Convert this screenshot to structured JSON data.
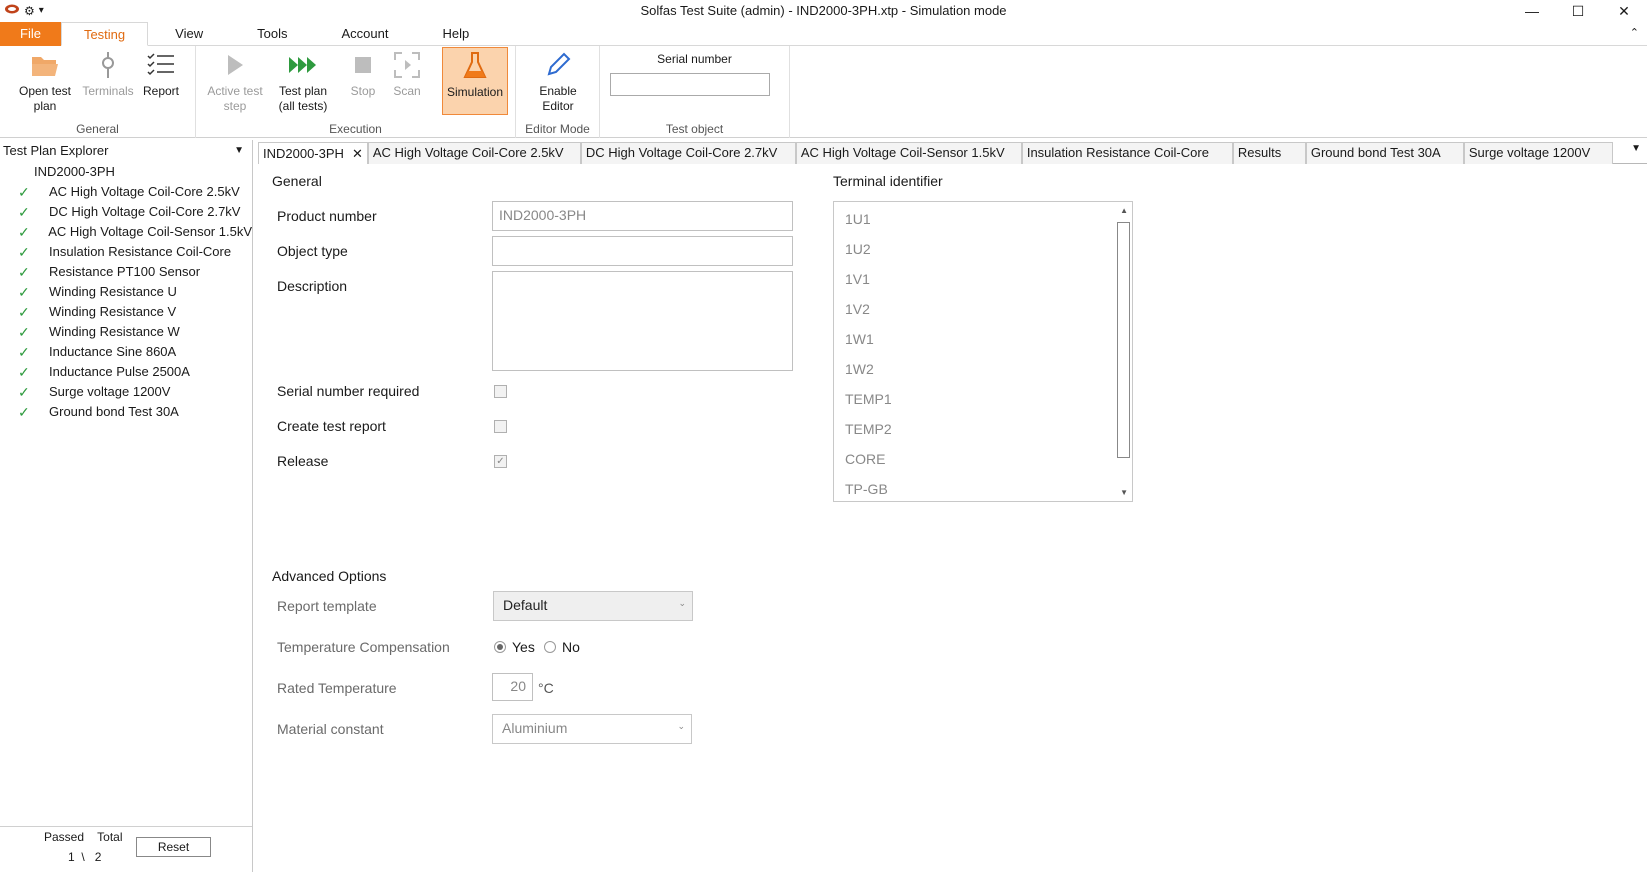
{
  "window": {
    "title": "Solfas Test Suite (admin)  - IND2000-3PH.xtp - Simulation mode",
    "qat_dropdown": "▾"
  },
  "ribbon_tabs": [
    "File",
    "Testing",
    "View",
    "Tools",
    "Account",
    "Help"
  ],
  "ribbon": {
    "general": {
      "label": "General",
      "open_test_plan": "Open test plan",
      "terminals": "Terminals",
      "report": "Report"
    },
    "execution": {
      "label": "Execution",
      "active_test_step": "Active test step",
      "test_plan_all": "Test plan (all tests)",
      "stop": "Stop",
      "scan": "Scan",
      "simulation": "Simulation"
    },
    "editor_mode": {
      "label": "Editor Mode",
      "enable_editor": "Enable Editor"
    },
    "test_object": {
      "label": "Test object",
      "serial_number_label": "Serial number",
      "serial_number_value": ""
    }
  },
  "explorer": {
    "title": "Test Plan Explorer",
    "root": "IND2000-3PH",
    "items": [
      "AC High Voltage Coil-Core 2.5kV",
      "DC High Voltage Coil-Core 2.7kV",
      "AC High Voltage Coil-Sensor 1.5kV",
      "Insulation Resistance Coil-Core",
      "Resistance PT100 Sensor",
      "Winding Resistance U",
      "Winding Resistance  V",
      "Winding Resistance  W",
      "Inductance Sine 860A",
      "Inductance Pulse 2500A",
      "Surge voltage 1200V",
      "Ground bond Test 30A"
    ],
    "footer": {
      "passed_label": "Passed",
      "total_label": "Total",
      "passed": "1",
      "separator": "\\",
      "total": "2",
      "reset": "Reset"
    }
  },
  "doc_tabs": [
    "IND2000-3PH",
    "AC High Voltage Coil-Core 2.5kV",
    "DC High Voltage Coil-Core 2.7kV",
    "AC High Voltage Coil-Sensor 1.5kV",
    "Insulation Resistance Coil-Core",
    "Results",
    "Ground bond Test 30A",
    "Surge voltage 1200V"
  ],
  "form": {
    "general_title": "General",
    "product_number_label": "Product number",
    "product_number_value": "IND2000-3PH",
    "object_type_label": "Object type",
    "object_type_value": "",
    "description_label": "Description",
    "description_value": "",
    "serial_required_label": "Serial number required",
    "serial_required_checked": false,
    "create_report_label": "Create test report",
    "create_report_checked": false,
    "release_label": "Release",
    "release_checked": true,
    "terminal_title": "Terminal identifier",
    "terminals": [
      "1U1",
      "1U2",
      "1V1",
      "1V2",
      "1W1",
      "1W2",
      "TEMP1",
      "TEMP2",
      "CORE",
      "TP-GB"
    ],
    "advanced_title": "Advanced Options",
    "report_template_label": "Report template",
    "report_template_value": "Default",
    "temp_comp_label": "Temperature Compensation",
    "temp_comp_yes": "Yes",
    "temp_comp_no": "No",
    "temp_comp_selected": "Yes",
    "rated_temp_label": "Rated Temperature",
    "rated_temp_value": "20",
    "rated_temp_unit": "°C",
    "material_label": "Material constant",
    "material_value": "Aluminium"
  },
  "colors": {
    "accent": "#f07a1a",
    "check": "#2e9a3e",
    "simulation_bg": "#fbd3ad"
  }
}
